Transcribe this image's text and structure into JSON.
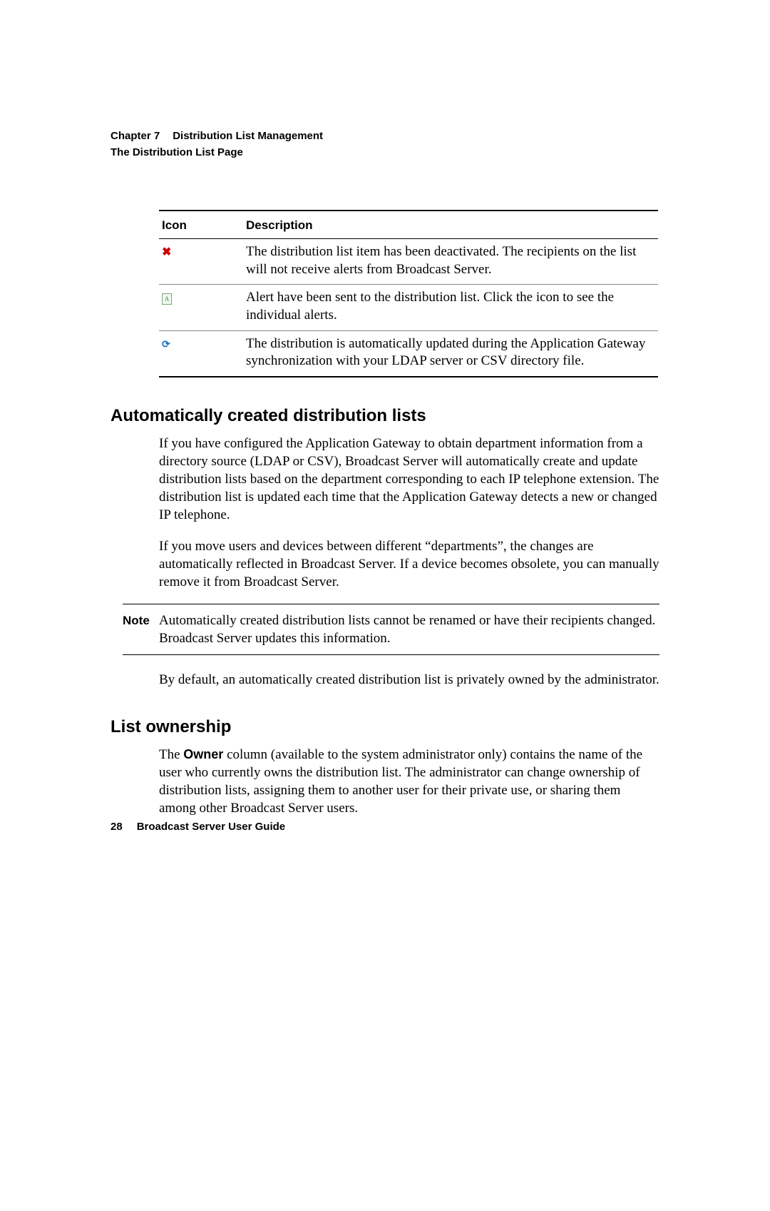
{
  "header": {
    "chapter_label": "Chapter 7",
    "chapter_title": "Distribution List Management",
    "section_title": "The Distribution List Page"
  },
  "table": {
    "headers": {
      "icon": "Icon",
      "description": "Description"
    },
    "rows": [
      {
        "icon_name": "x-icon",
        "description": "The distribution list item has been deactivated. The recipients on the list will not receive alerts from Broadcast Server."
      },
      {
        "icon_name": "document-icon",
        "description": "Alert have been sent to the distribution list. Click the icon to see the individual alerts."
      },
      {
        "icon_name": "sync-icon",
        "description": "The distribution is automatically updated during the Application Gateway synchronization with your LDAP server or CSV directory file."
      }
    ]
  },
  "section1": {
    "heading": "Automatically created distribution lists",
    "para1": "If you have configured the Application Gateway to obtain department information from a directory source (LDAP or CSV), Broadcast Server will automatically create and update distribution lists based on the department corresponding to each IP telephone extension. The distribution list is updated each time that the Application Gateway detects a new or changed IP telephone.",
    "para2": "If you move users and devices between different “departments”, the changes are automatically reflected in Broadcast Server. If a device becomes obsolete, you can manually remove it from Broadcast Server.",
    "note_label": "Note",
    "note_text": "Automatically created distribution lists cannot be renamed or have their recipients changed. Broadcast Server updates this information.",
    "para3": "By default, an automatically created distribution list is privately owned by the administrator."
  },
  "section2": {
    "heading": "List ownership",
    "para_prefix": "The ",
    "owner_word": "Owner",
    "para_suffix": " column (available to the system administrator only) contains the name of the user who currently owns the distribution list. The administrator can change ownership of distribution lists, assigning them to another user for their private use, or sharing them among other Broadcast Server users."
  },
  "footer": {
    "page_number": "28",
    "guide_title": "Broadcast Server User Guide"
  }
}
